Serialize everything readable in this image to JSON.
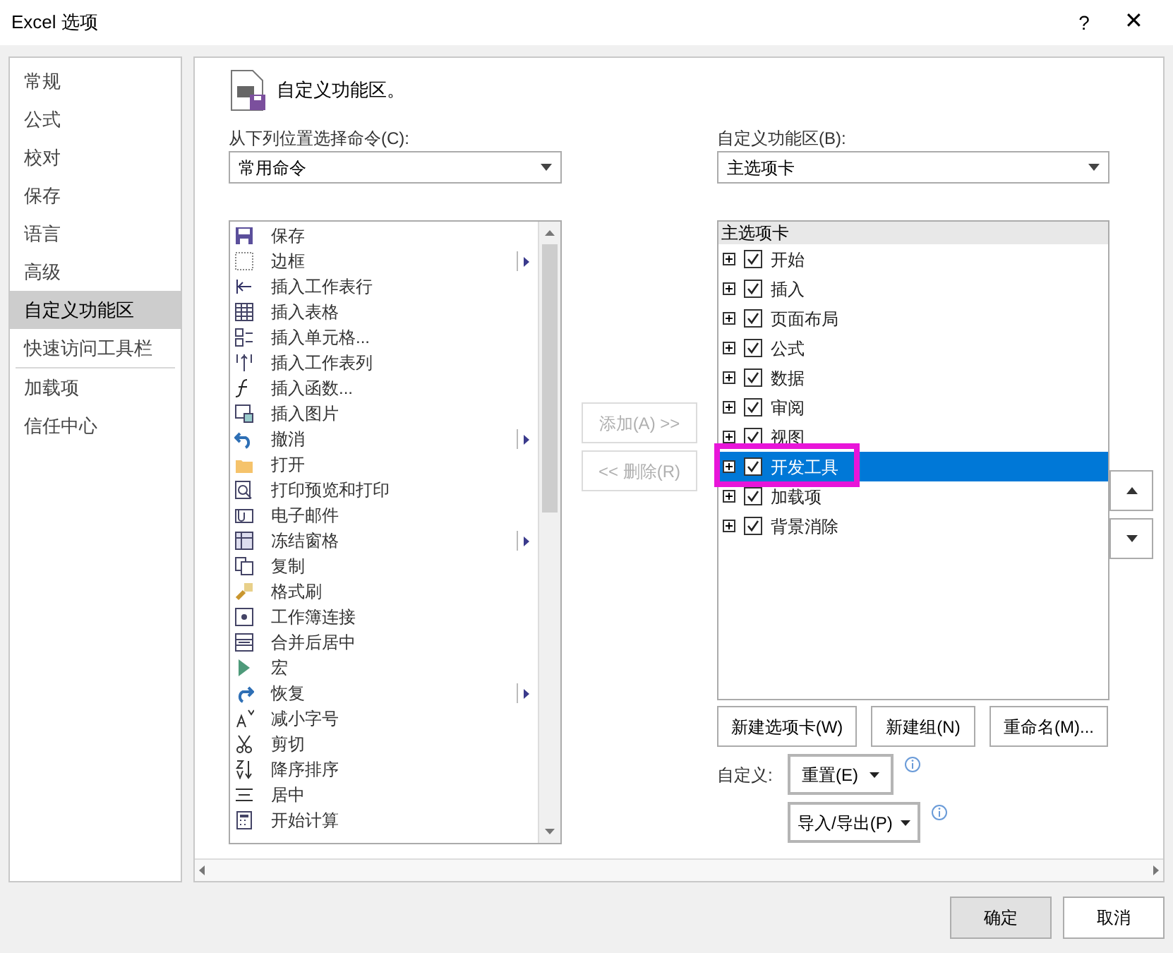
{
  "window": {
    "title": "Excel 选项",
    "help": "?",
    "close": "✕"
  },
  "nav": [
    {
      "label": "常规",
      "selected": false
    },
    {
      "label": "公式",
      "selected": false
    },
    {
      "label": "校对",
      "selected": false
    },
    {
      "label": "保存",
      "selected": false
    },
    {
      "label": "语言",
      "selected": false
    },
    {
      "label": "高级",
      "selected": false
    },
    {
      "label": "自定义功能区",
      "selected": true
    },
    {
      "label": "快速访问工具栏",
      "selected": false
    },
    {
      "label": "加载项",
      "selected": false
    },
    {
      "label": "信任中心",
      "selected": false
    }
  ],
  "heading": "自定义功能区。",
  "commands_source": {
    "label": "从下列位置选择命令(C):",
    "value": "常用命令"
  },
  "commands": [
    {
      "label": "保存",
      "submenu": false
    },
    {
      "label": "边框",
      "submenu": true
    },
    {
      "label": "插入工作表行",
      "submenu": false
    },
    {
      "label": "插入表格",
      "submenu": false
    },
    {
      "label": "插入单元格...",
      "submenu": false
    },
    {
      "label": "插入工作表列",
      "submenu": false
    },
    {
      "label": "插入函数...",
      "submenu": false
    },
    {
      "label": "插入图片",
      "submenu": false
    },
    {
      "label": "撤消",
      "submenu": true
    },
    {
      "label": "打开",
      "submenu": false
    },
    {
      "label": "打印预览和打印",
      "submenu": false
    },
    {
      "label": "电子邮件",
      "submenu": false
    },
    {
      "label": "冻结窗格",
      "submenu": true
    },
    {
      "label": "复制",
      "submenu": false
    },
    {
      "label": "格式刷",
      "submenu": false
    },
    {
      "label": "工作簿连接",
      "submenu": false
    },
    {
      "label": "合并后居中",
      "submenu": false
    },
    {
      "label": "宏",
      "submenu": false
    },
    {
      "label": "恢复",
      "submenu": true
    },
    {
      "label": "减小字号",
      "submenu": false
    },
    {
      "label": "剪切",
      "submenu": false
    },
    {
      "label": "降序排序",
      "submenu": false
    },
    {
      "label": "居中",
      "submenu": false
    },
    {
      "label": "开始计算",
      "submenu": false
    }
  ],
  "add_button": {
    "label": "添加(A) >>",
    "disabled": true
  },
  "remove_button": {
    "label": "<< 删除(R)",
    "disabled": true
  },
  "ribbon_target": {
    "label": "自定义功能区(B):",
    "value": "主选项卡"
  },
  "tabs_tree": {
    "header": "主选项卡",
    "items": [
      {
        "label": "开始",
        "checked": true,
        "selected": false
      },
      {
        "label": "插入",
        "checked": true,
        "selected": false
      },
      {
        "label": "页面布局",
        "checked": true,
        "selected": false
      },
      {
        "label": "公式",
        "checked": true,
        "selected": false
      },
      {
        "label": "数据",
        "checked": true,
        "selected": false
      },
      {
        "label": "审阅",
        "checked": true,
        "selected": false
      },
      {
        "label": "视图",
        "checked": true,
        "selected": false
      },
      {
        "label": "开发工具",
        "checked": true,
        "selected": true
      },
      {
        "label": "加载项",
        "checked": true,
        "selected": false
      },
      {
        "label": "背景消除",
        "checked": true,
        "selected": false
      }
    ]
  },
  "tree_buttons": [
    "新建选项卡(W)",
    "新建组(N)",
    "重命名(M)..."
  ],
  "customize_label": "自定义:",
  "reset_button": "重置(E)",
  "import_export_button": "导入/导出(P)",
  "ok_button": "确定",
  "cancel_button": "取消"
}
